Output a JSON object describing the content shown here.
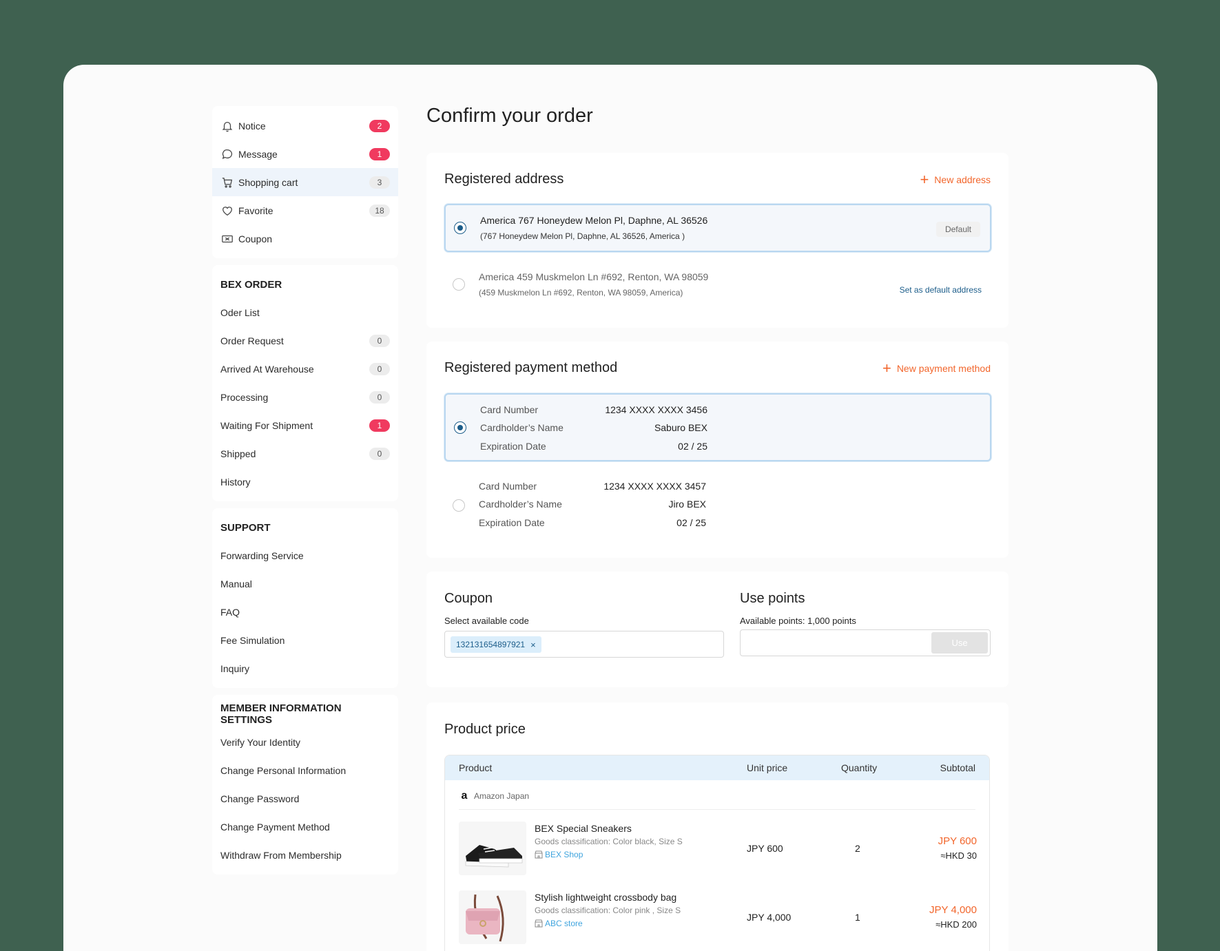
{
  "sidebar": {
    "top_items": [
      {
        "label": "Notice",
        "icon": "bell-icon",
        "badge": "2",
        "badge_style": "red"
      },
      {
        "label": "Message",
        "icon": "message-icon",
        "badge": "1",
        "badge_style": "red"
      },
      {
        "label": "Shopping cart",
        "icon": "cart-icon",
        "badge": "3",
        "badge_style": "gray"
      },
      {
        "label": "Favorite",
        "icon": "heart-icon",
        "badge": "18",
        "badge_style": "gray"
      },
      {
        "label": "Coupon",
        "icon": "coupon-icon",
        "badge": "",
        "badge_style": ""
      }
    ],
    "order_heading": "BEX ORDER",
    "order_items": [
      {
        "label": "Oder List",
        "badge": ""
      },
      {
        "label": "Order Request",
        "badge": "0"
      },
      {
        "label": "Arrived At Warehouse",
        "badge": "0"
      },
      {
        "label": "Processing",
        "badge": "0"
      },
      {
        "label": "Waiting For Shipment",
        "badge": "1"
      },
      {
        "label": "Shipped",
        "badge": "0"
      },
      {
        "label": "History",
        "badge": ""
      }
    ],
    "support_heading": "SUPPORT",
    "support_items": [
      "Forwarding Service",
      "Manual",
      "FAQ",
      "Fee Simulation",
      "Inquiry"
    ],
    "member_heading": "MEMBER INFORMATION SETTINGS",
    "member_items": [
      "Verify Your Identity",
      "Change Personal Information",
      "Change Password",
      "Change Payment Method",
      "Withdraw From Membership"
    ]
  },
  "page_title": "Confirm your order",
  "address": {
    "title": "Registered address",
    "new_label": "New address",
    "items": [
      {
        "line1": "America 767 Honeydew Melon Pl, Daphne, AL 36526",
        "line2": "(767 Honeydew Melon Pl, Daphne, AL 36526, America )",
        "tag": "Default",
        "selected": true
      },
      {
        "line1": "America 459 Muskmelon Ln #692, Renton, WA 98059",
        "line2": "(459 Muskmelon Ln #692, Renton, WA 98059, America)",
        "action": "Set as default address",
        "selected": false
      }
    ]
  },
  "payment": {
    "title": "Registered payment method",
    "new_label": "New payment method",
    "labels": {
      "card": "Card Number",
      "holder": "Cardholder’s Name",
      "exp": "Expiration Date"
    },
    "cards": [
      {
        "number": "1234 XXXX XXXX 3456",
        "holder": "Saburo BEX",
        "exp": "02 / 25",
        "selected": true
      },
      {
        "number": "1234 XXXX XXXX 3457",
        "holder": "Jiro BEX",
        "exp": "02 / 25",
        "selected": false
      }
    ]
  },
  "coupon": {
    "title": "Coupon",
    "label": "Select available code",
    "code": "132131654897921",
    "remove": "×"
  },
  "points": {
    "title": "Use points",
    "label": "Available points:",
    "value": "1,000 points",
    "button": "Use"
  },
  "product": {
    "title": "Product price",
    "headers": {
      "product": "Product",
      "unit": "Unit price",
      "qty": "Quantity",
      "subtotal": "Subtotal"
    },
    "store": "Amazon Japan",
    "items": [
      {
        "name": "BEX Special Sneakers",
        "cls": "Goods classification: Color black, Size S",
        "shop": "BEX Shop",
        "unit": "JPY 600",
        "qty": "2",
        "sub1": "JPY 600",
        "sub2": "≈HKD 30"
      },
      {
        "name": "Stylish lightweight crossbody bag",
        "cls": "Goods classification: Color pink , Size S",
        "shop": "ABC store",
        "unit": "JPY 4,000",
        "qty": "1",
        "sub1": "JPY 4,000",
        "sub2": "≈HKD 200"
      }
    ]
  }
}
